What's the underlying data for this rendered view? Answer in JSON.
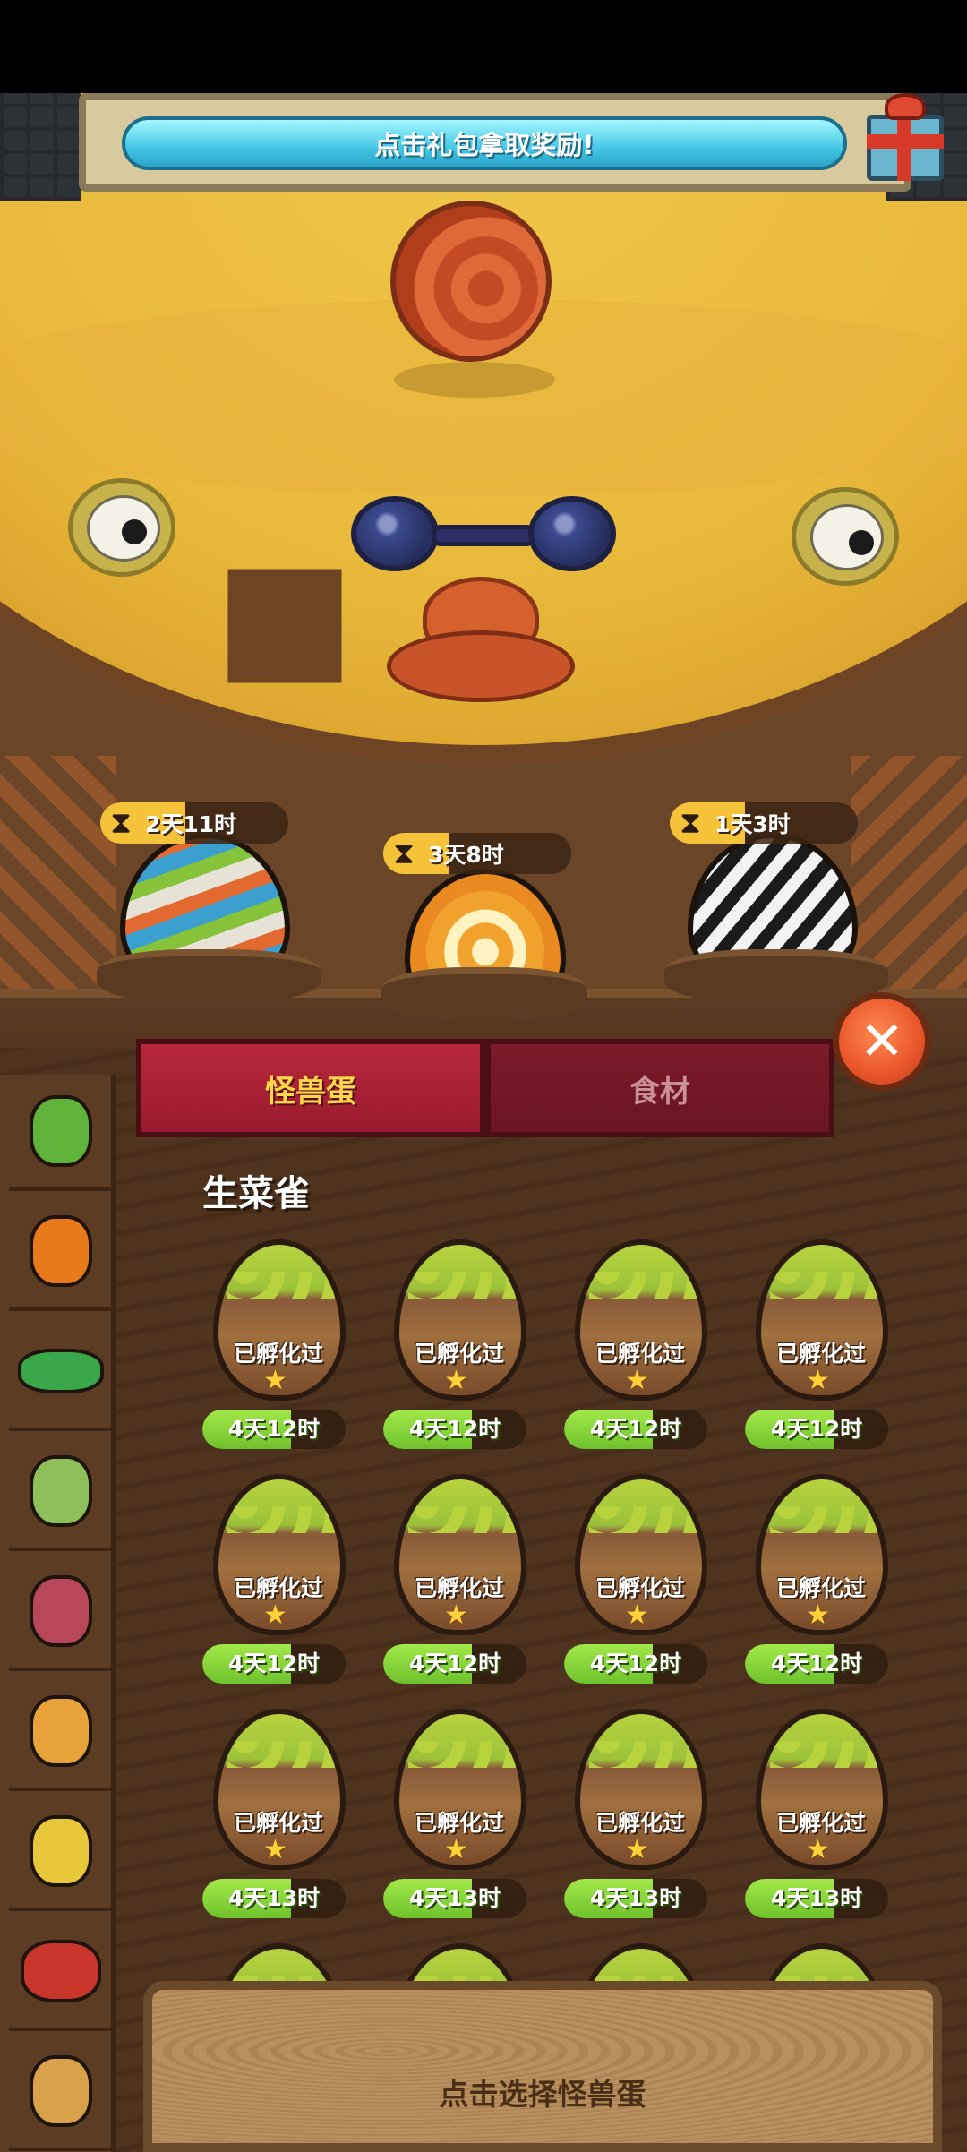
{
  "banner": {
    "text": "点击礼包拿取奖励!"
  },
  "slots": [
    {
      "time": "2天11时",
      "fill": 0.45
    },
    {
      "time": "3天8时",
      "fill": 0.35
    },
    {
      "time": "1天3时",
      "fill": 0.4
    }
  ],
  "tabs": {
    "eggs": "怪兽蛋",
    "ingredients": "食材"
  },
  "section": {
    "title": "生菜雀"
  },
  "eggs": [
    {
      "status": "已孵化过",
      "time": "4天12时"
    },
    {
      "status": "已孵化过",
      "time": "4天12时"
    },
    {
      "status": "已孵化过",
      "time": "4天12时"
    },
    {
      "status": "已孵化过",
      "time": "4天12时"
    },
    {
      "status": "已孵化过",
      "time": "4天12时"
    },
    {
      "status": "已孵化过",
      "time": "4天12时"
    },
    {
      "status": "已孵化过",
      "time": "4天12时"
    },
    {
      "status": "已孵化过",
      "time": "4天12时"
    },
    {
      "status": "已孵化过",
      "time": "4天13时"
    },
    {
      "status": "已孵化过",
      "time": "4天13时"
    },
    {
      "status": "已孵化过",
      "time": "4天13时"
    },
    {
      "status": "已孵化过",
      "time": "4天13时"
    }
  ],
  "bottom": {
    "hint": "点击选择怪兽蛋"
  },
  "icons": {
    "hourglass": "hourglass-icon",
    "close": "close-icon",
    "star": "star-icon",
    "gift": "gift-icon"
  },
  "colors": {
    "active_tab": "#b8283b",
    "timer_fill": "#f5c33a",
    "egg_time_fill": "#8fd83c"
  }
}
